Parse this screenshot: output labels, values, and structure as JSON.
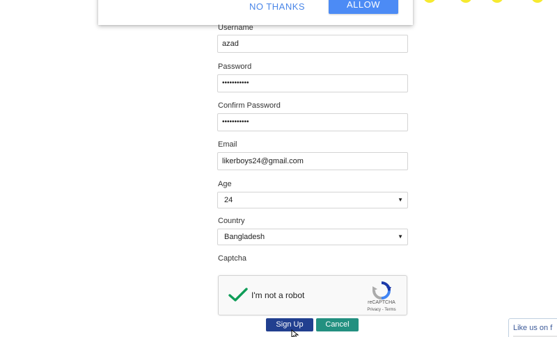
{
  "permission_popup": {
    "no_thanks_label": "NO THANKS",
    "allow_label": "ALLOW"
  },
  "form": {
    "username": {
      "label": "Username",
      "value": "azad"
    },
    "password": {
      "label": "Password",
      "value": "•••••••••••"
    },
    "confirm_password": {
      "label": "Confirm Password",
      "value": "•••••••••••"
    },
    "email": {
      "label": "Email",
      "value": "likerboys24@gmail.com"
    },
    "age": {
      "label": "Age",
      "selected": "24"
    },
    "country": {
      "label": "Country",
      "selected": "Bangladesh"
    },
    "captcha": {
      "label": "Captcha",
      "checkbox_text": "I'm not a robot",
      "brand": "reCAPTCHA",
      "links": "Privacy - Terms"
    },
    "signup_label": "Sign Up",
    "cancel_label": "Cancel"
  },
  "like_widget": {
    "text": "Like us on f"
  },
  "colors": {
    "allow_button": "#4c8bf5",
    "signup_button": "#213f8f",
    "cancel_button": "#239080",
    "captcha_check": "#0f9d58"
  },
  "icons": [
    "checkmark-icon",
    "recaptcha-logo-icon",
    "dropdown-arrow-icon",
    "mouse-cursor-icon"
  ]
}
